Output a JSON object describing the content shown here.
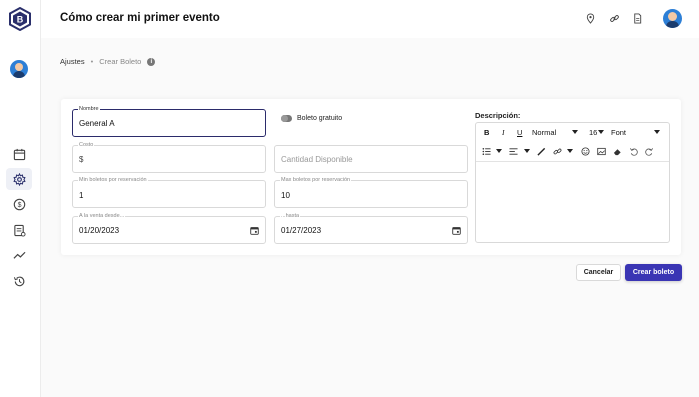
{
  "header": {
    "title": "Cómo crear mi primer evento",
    "icons": [
      "location-pin-icon",
      "link-icon",
      "document-icon"
    ]
  },
  "sidebar": {
    "items": [
      {
        "icon": "calendar-icon"
      },
      {
        "icon": "gear-icon",
        "active": true
      },
      {
        "icon": "dollar-icon"
      },
      {
        "icon": "report-icon"
      },
      {
        "icon": "trend-icon"
      },
      {
        "icon": "history-icon"
      }
    ]
  },
  "breadcrumb": {
    "root": "Ajustes",
    "separator": "•",
    "current": "Crear Boleto"
  },
  "form": {
    "name": {
      "label": "Nombre",
      "value": "General A"
    },
    "free_ticket_label": "Boleto gratuito",
    "cost": {
      "label": "Costo",
      "prefix": "$"
    },
    "quantity": {
      "placeholder": "Cantidad Disponible"
    },
    "min_per_reservation": {
      "label": "Min boletos por reservación",
      "value": "1"
    },
    "max_per_reservation": {
      "label": "Max boletos por reservación",
      "value": "10"
    },
    "sale_from": {
      "label": "A la venta desde...",
      "value": "01/20/2023"
    },
    "sale_until": {
      "label": "...hasta",
      "value": "01/27/2023"
    }
  },
  "description": {
    "label": "Descripción:",
    "toolbar": {
      "bold": "B",
      "italic": "I",
      "underline": "U",
      "format": "Normal",
      "size": "16",
      "font": "Font"
    }
  },
  "actions": {
    "cancel": "Cancelar",
    "create": "Crear boleto"
  },
  "colors": {
    "primary": "#3a35b4",
    "focus_border": "#2b2b6b"
  }
}
